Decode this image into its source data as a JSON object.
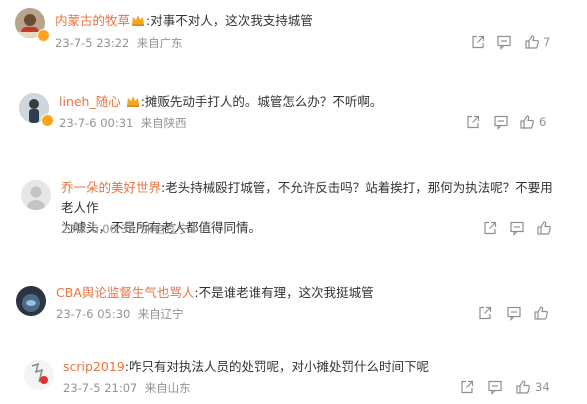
{
  "comments": [
    {
      "username": "内蒙古的牧草",
      "content": ":对事不对人，这次我支持城管",
      "date": "23-7-5 23:22",
      "location": "来自广东",
      "likes": "7"
    },
    {
      "username": "lineh_随心",
      "content": ":摊贩先动手打人的。城管怎么办？不听啊。",
      "date": "23-7-6 00:31",
      "location": "来自陕西",
      "likes": "6"
    },
    {
      "username": "乔一朵的美好世界",
      "content_line1": ":老头持械殴打城管，不允许反击吗？站着挨打，那何为执法呢？不要用老人作",
      "content_line2": "为噱头，不是所有老人都值得同情。",
      "date": "23-7-6 06:36",
      "location": "来自辽宁",
      "likes": ""
    },
    {
      "username": "CBA舆论监督生气也骂人",
      "content": ":不是谁老谁有理，这次我挺城管",
      "date": "23-7-6 05:30",
      "location": "来自辽宁",
      "likes": ""
    },
    {
      "username": "scrip2019",
      "content": ":咋只有对执法人员的处罚呢，对小摊处罚什么时间下呢",
      "date": "23-7-5 21:07",
      "location": "来自山东",
      "likes": "34"
    }
  ],
  "icons": {
    "share": "share-icon",
    "comment": "comment-icon",
    "like": "thumbs-up-icon",
    "vip": "crown-icon",
    "verified": "verified-badge-icon"
  },
  "colors": {
    "username": "#eb7340",
    "text": "#333333",
    "meta": "#939393",
    "icon": "#8f8f8f",
    "crown": "#f5a623"
  }
}
